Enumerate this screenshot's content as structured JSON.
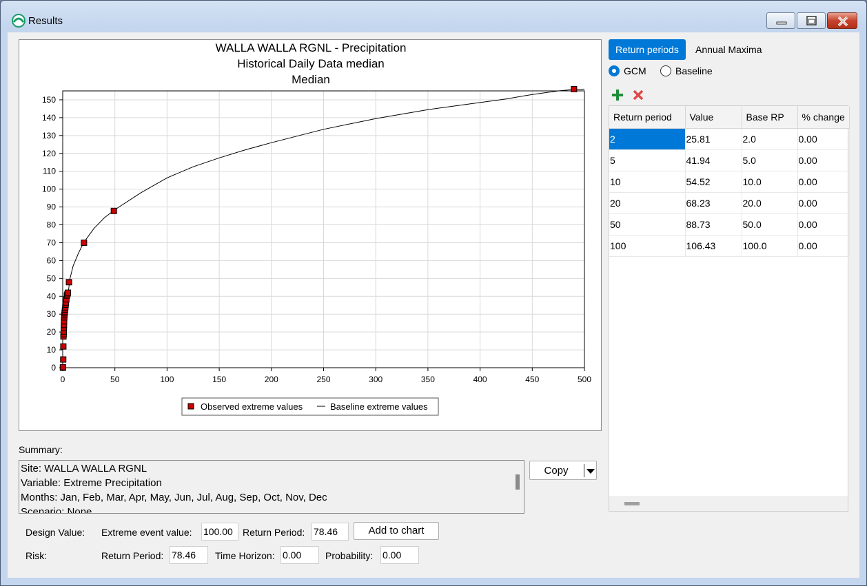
{
  "window": {
    "title": "Results"
  },
  "chart_data": {
    "type": "scatter",
    "title": "WALLA WALLA RGNL - Precipitation",
    "subtitle": "Historical Daily Data median",
    "subtitle2": "Median",
    "xlabel": "",
    "ylabel": "",
    "xlim": [
      0,
      500
    ],
    "ylim": [
      0,
      155
    ],
    "x_ticks": [
      0,
      50,
      100,
      150,
      200,
      250,
      300,
      350,
      400,
      450,
      500
    ],
    "y_ticks": [
      0,
      10,
      20,
      30,
      40,
      50,
      60,
      70,
      80,
      90,
      100,
      110,
      120,
      130,
      140,
      150
    ],
    "grid": true,
    "legend_position": "bottom",
    "series": [
      {
        "name": "Observed extreme values",
        "kind": "markers",
        "color": "#cc0000",
        "x": [
          0.2,
          0.3,
          0.5,
          0.6,
          0.7,
          0.9,
          1.0,
          1.1,
          1.2,
          1.3,
          1.5,
          1.6,
          1.8,
          2.0,
          2.2,
          2.5,
          2.8,
          3.1,
          3.5,
          4.0,
          4.5,
          5.0,
          6.0,
          20.4,
          49.0,
          490.0
        ],
        "y": [
          0.0,
          0.3,
          4.6,
          11.9,
          17.5,
          18.8,
          20.3,
          22.3,
          24.0,
          26.1,
          28.2,
          29.4,
          30.5,
          31.3,
          32.6,
          33.8,
          35.3,
          36.5,
          38.3,
          40.4,
          41.2,
          42.0,
          47.9,
          70.0,
          87.8,
          156.0
        ]
      },
      {
        "name": "Baseline extreme values",
        "kind": "line",
        "color": "#000000",
        "x": [
          1.0,
          1.5,
          2.0,
          3.0,
          4.0,
          5.0,
          7.0,
          10.0,
          15.0,
          20.0,
          30.0,
          40.0,
          50.0,
          75.0,
          100.0,
          125.0,
          150.0,
          175.0,
          200.0,
          250.0,
          300.0,
          350.0,
          400.0,
          425.0,
          450.0,
          475.0,
          490.0,
          500.0
        ],
        "y": [
          21.0,
          25.0,
          28.0,
          33.0,
          37.0,
          41.0,
          50.0,
          57.0,
          64.0,
          70.0,
          78.0,
          84.0,
          88.5,
          98.0,
          106.3,
          112.5,
          117.5,
          122.0,
          126.0,
          133.5,
          139.5,
          144.5,
          148.5,
          150.5,
          153.0,
          155.0,
          155.8,
          156.0
        ]
      }
    ]
  },
  "tabs": {
    "return_periods": "Return periods",
    "annual_maxima": "Annual Maxima"
  },
  "radios": {
    "gcm": "GCM",
    "baseline": "Baseline",
    "selected": "GCM"
  },
  "toolbar": {
    "add_icon": "plus-icon",
    "remove_icon": "x-icon"
  },
  "table": {
    "columns": [
      "Return period",
      "Value",
      "Base RP",
      "% change"
    ],
    "rows": [
      [
        "2",
        "25.81",
        "2.0",
        "0.00"
      ],
      [
        "5",
        "41.94",
        "5.0",
        "0.00"
      ],
      [
        "10",
        "54.52",
        "10.0",
        "0.00"
      ],
      [
        "20",
        "68.23",
        "20.0",
        "0.00"
      ],
      [
        "50",
        "88.73",
        "50.0",
        "0.00"
      ],
      [
        "100",
        "106.43",
        "100.0",
        "0.00"
      ]
    ]
  },
  "summary": {
    "label": "Summary:",
    "lines": [
      "Site: WALLA WALLA RGNL",
      "Variable: Extreme Precipitation",
      "Months: Jan, Feb, Mar, Apr, May, Jun, Jul, Aug, Sep, Oct, Nov, Dec",
      "Scenario: None"
    ],
    "copy_label": "Copy"
  },
  "design": {
    "label": "Design Value:",
    "extreme_label": "Extreme event value:",
    "extreme_value": "100.00",
    "rp_label": "Return Period:",
    "rp_value": "78.46",
    "add_button": "Add to chart"
  },
  "risk": {
    "label": "Risk:",
    "rp_label": "Return Period:",
    "rp_value": "78.46",
    "horizon_label": "Time Horizon:",
    "horizon_value": "0.00",
    "prob_label": "Probability:",
    "prob_value": "0.00"
  },
  "colors": {
    "accent": "#0078d7",
    "marker": "#cc0000",
    "add_icon": "#1e8c3a",
    "remove_icon": "#e04848"
  }
}
